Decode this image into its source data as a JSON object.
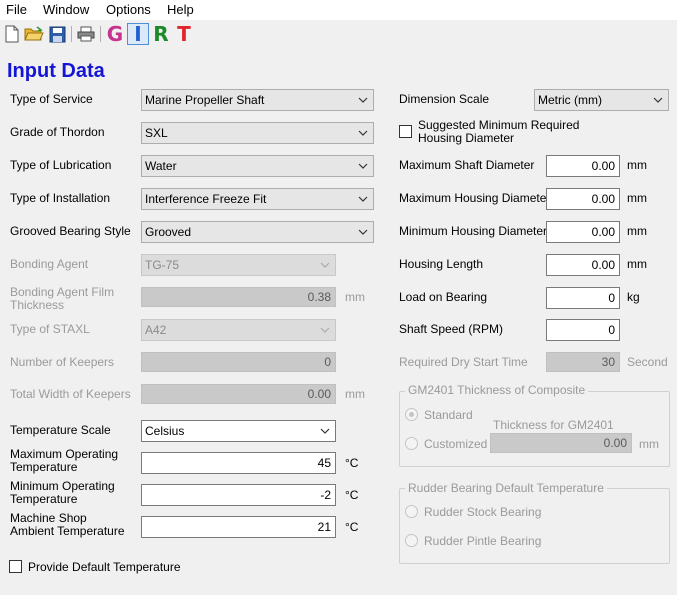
{
  "menu": [
    "File",
    "Window",
    "Options",
    "Help"
  ],
  "toolbar": {
    "icons": [
      "new-document-icon",
      "open-folder-icon",
      "save-icon",
      "print-icon"
    ],
    "letters": [
      {
        "text": "G",
        "color": "#c6338f"
      },
      {
        "text": "I",
        "color": "#1f5fd0"
      },
      {
        "text": "R",
        "color": "#1c8a2a"
      },
      {
        "text": "T",
        "color": "#e0262b"
      }
    ]
  },
  "heading": "Input Data",
  "left": {
    "type_of_service": {
      "label": "Type of Service",
      "value": "Marine Propeller Shaft"
    },
    "grade_of_thordon": {
      "label": "Grade of Thordon",
      "value": "SXL"
    },
    "type_of_lubrication": {
      "label": "Type of Lubrication",
      "value": "Water"
    },
    "type_of_installation": {
      "label": "Type of Installation",
      "value": "Interference Freeze Fit"
    },
    "grooved_bearing_style": {
      "label": "Grooved Bearing Style",
      "value": "Grooved"
    },
    "bonding_agent": {
      "label": "Bonding Agent",
      "value": "TG-75"
    },
    "bonding_film": {
      "label_line1": "Bonding Agent Film",
      "label_line2": "Thickness",
      "value": "0.38",
      "unit": "mm"
    },
    "type_of_staxl": {
      "label": "Type of STAXL",
      "value": "A42"
    },
    "number_of_keepers": {
      "label": "Number of Keepers",
      "value": "0"
    },
    "total_width_keepers": {
      "label": "Total Width of Keepers",
      "value": "0.00",
      "unit": "mm"
    },
    "temperature_scale": {
      "label": "Temperature Scale",
      "value": "Celsius"
    },
    "max_operating_temp": {
      "label_line1": "Maximum Operating",
      "label_line2": "Temperature",
      "value": "45",
      "unit": "°C"
    },
    "min_operating_temp": {
      "label_line1": "Minimum Operating",
      "label_line2": "Temperature",
      "value": "-2",
      "unit": "°C"
    },
    "machine_shop_temp": {
      "label_line1": "Machine Shop",
      "label_line2": "Ambient Temperature",
      "value": "21",
      "unit": "°C"
    },
    "provide_default_temp": {
      "label": "Provide Default Temperature"
    }
  },
  "right": {
    "dimension_scale": {
      "label": "Dimension Scale",
      "value": "Metric (mm)"
    },
    "suggested_min": {
      "label_line1": "Suggested Minimum Required",
      "label_line2": "Housing Diameter"
    },
    "max_shaft_diameter": {
      "label": "Maximum Shaft Diameter",
      "value": "0.00",
      "unit": "mm"
    },
    "max_housing_diameter": {
      "label": "Maximum Housing Diameter",
      "value": "0.00",
      "unit": "mm"
    },
    "min_housing_diameter": {
      "label": "Minimum Housing Diameter",
      "value": "0.00",
      "unit": "mm"
    },
    "housing_length": {
      "label": "Housing Length",
      "value": "0.00",
      "unit": "mm"
    },
    "load_on_bearing": {
      "label": "Load on Bearing",
      "value": "0",
      "unit": "kg"
    },
    "shaft_speed": {
      "label": "Shaft Speed (RPM)",
      "value": "0"
    },
    "dry_start_time": {
      "label": "Required Dry Start Time",
      "value": "30",
      "unit": "Second"
    },
    "gm2401": {
      "title": "GM2401 Thickness of Composite",
      "standard": "Standard",
      "customized": "Customized",
      "thickness_label": "Thickness for GM2401",
      "thickness_value": "0.00",
      "unit": "mm"
    },
    "rudder": {
      "title": "Rudder Bearing Default Temperature",
      "stock": "Rudder Stock Bearing",
      "pintle": "Rudder Pintle Bearing"
    }
  }
}
